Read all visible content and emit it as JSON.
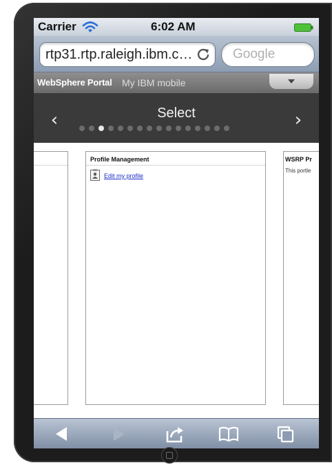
{
  "status_bar": {
    "carrier": "Carrier",
    "time": "6:02 AM"
  },
  "browser": {
    "url": "rtp31.rtp.raleigh.ibm.c…",
    "search_placeholder": "Google"
  },
  "portal": {
    "brand": "WebSphere Portal",
    "title": "My IBM mobile"
  },
  "carousel": {
    "title": "Select",
    "prev_glyph": "‹",
    "next_glyph": "›",
    "dot_count": 16,
    "active_dot": 3
  },
  "panels": {
    "center": {
      "header": "Profile Management",
      "link": "Edit my profile"
    },
    "right": {
      "header": "WSRP Pr",
      "desc": "This portle"
    }
  },
  "toolbar": {
    "items": [
      "back-icon",
      "forward-icon",
      "share-icon",
      "bookmarks-icon",
      "tabs-icon"
    ]
  },
  "colors": {
    "status_bar": "#d8dee6",
    "url_bar": "#a3b1c3",
    "portal_bar": "#7d7d7d",
    "nav_bar": "#3a3a3a",
    "link": "#1a2cc9",
    "battery": "#4fc13a"
  }
}
